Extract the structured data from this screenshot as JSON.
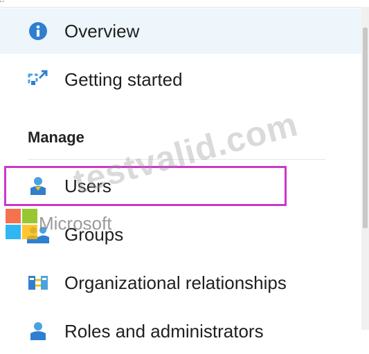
{
  "nav": {
    "items": [
      {
        "label": "Overview",
        "icon": "info-icon"
      },
      {
        "label": "Getting started",
        "icon": "quickstart-icon"
      },
      {
        "label": "Users",
        "icon": "user-icon"
      },
      {
        "label": "Groups",
        "icon": "groups-icon"
      },
      {
        "label": "Organizational relationships",
        "icon": "org-relationships-icon"
      },
      {
        "label": "Roles and administrators",
        "icon": "roles-icon"
      }
    ],
    "section_manage": "Manage"
  },
  "overlay": {
    "watermark": "testvalid.com",
    "logo_text": "Microsoft"
  },
  "colors": {
    "accent": "#0078d4",
    "highlight": "#cc36cc",
    "active_bg": "#eef6fc"
  }
}
